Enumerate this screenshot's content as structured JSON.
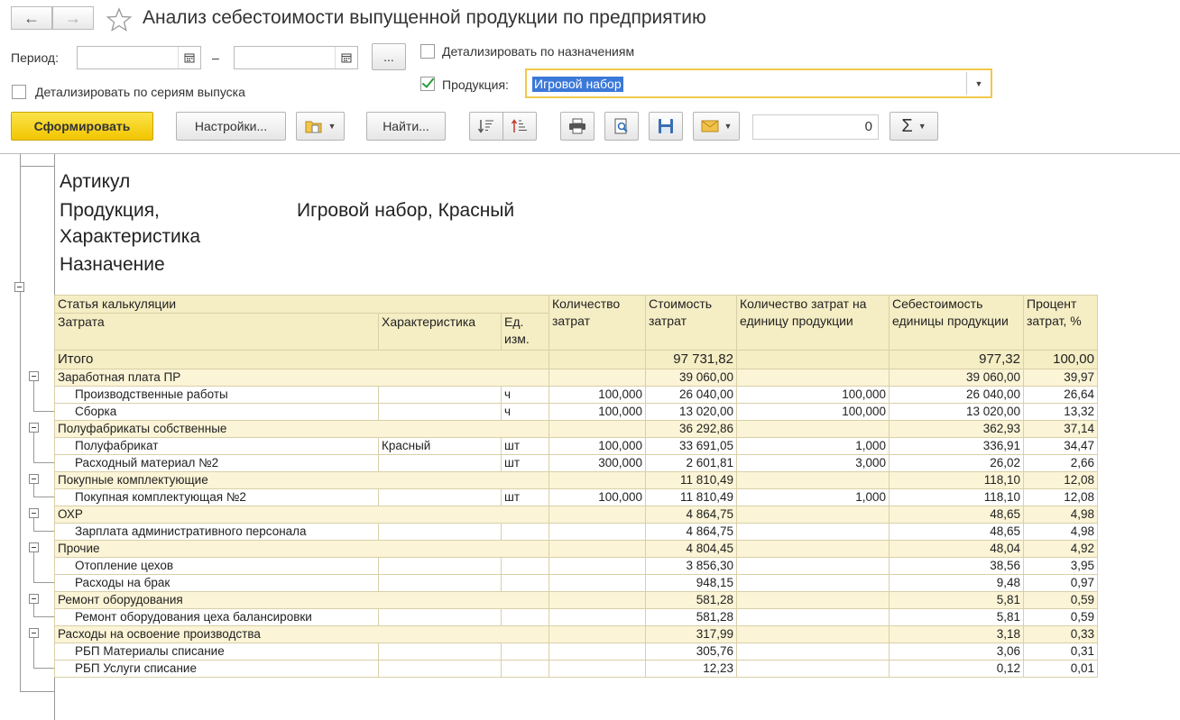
{
  "title": "Анализ себестоимости выпущенной продукции по предприятию",
  "nav": {
    "back_icon": "←",
    "forward_icon": "→"
  },
  "filters": {
    "period_label": "Период:",
    "period_dash": "–",
    "period_from": "",
    "period_to": "",
    "ellipsis": "...",
    "detail_by_purpose_label": "Детализировать по назначениям",
    "detail_by_series_label": "Детализировать по сериям выпуска",
    "product_label": "Продукция:",
    "product_value": "Игровой набор"
  },
  "toolbar": {
    "generate": "Сформировать",
    "settings": "Настройки...",
    "find": "Найти...",
    "sum_value": "0"
  },
  "report_header": {
    "article_label": "Артикул",
    "product_label_1": "Продукция,",
    "product_label_2": "Характеристика",
    "product_value": "Игровой набор, Красный",
    "purpose_label": "Назначение"
  },
  "table": {
    "headers": {
      "cost_item": "Статья калькуляции",
      "expense": "Затрата",
      "characteristic": "Характеристика",
      "unit": "Ед. изм.",
      "qty": "Количество затрат",
      "cost": "Стоимость затрат",
      "qty_per_unit": "Количество затрат на единицу продукции",
      "unit_cost": "Себестоимость единицы продукции",
      "pct": "Процент затрат, %"
    },
    "total": {
      "name": "Итого",
      "cost": "97 731,82",
      "unit_cost": "977,32",
      "pct": "100,00"
    },
    "groups": [
      {
        "name": "Заработная плата ПР",
        "cost": "39 060,00",
        "unit_cost": "39 060,00",
        "pct": "39,97",
        "items": [
          {
            "name": "Производственные работы",
            "char": "",
            "unit": "ч",
            "qty": "100,000",
            "cost": "26 040,00",
            "qpu": "100,000",
            "uc": "26 040,00",
            "pct": "26,64"
          },
          {
            "name": "Сборка",
            "char": "",
            "unit": "ч",
            "qty": "100,000",
            "cost": "13 020,00",
            "qpu": "100,000",
            "uc": "13 020,00",
            "pct": "13,32"
          }
        ]
      },
      {
        "name": "Полуфабрикаты собственные",
        "cost": "36 292,86",
        "unit_cost": "362,93",
        "pct": "37,14",
        "items": [
          {
            "name": "Полуфабрикат",
            "char": "Красный",
            "unit": "шт",
            "qty": "100,000",
            "cost": "33 691,05",
            "qpu": "1,000",
            "uc": "336,91",
            "pct": "34,47"
          },
          {
            "name": "Расходный материал №2",
            "char": "",
            "unit": "шт",
            "qty": "300,000",
            "cost": "2 601,81",
            "qpu": "3,000",
            "uc": "26,02",
            "pct": "2,66"
          }
        ]
      },
      {
        "name": "Покупные комплектующие",
        "cost": "11 810,49",
        "unit_cost": "118,10",
        "pct": "12,08",
        "items": [
          {
            "name": "Покупная комплектующая №2",
            "char": "",
            "unit": "шт",
            "qty": "100,000",
            "cost": "11 810,49",
            "qpu": "1,000",
            "uc": "118,10",
            "pct": "12,08"
          }
        ]
      },
      {
        "name": "ОХР",
        "cost": "4 864,75",
        "unit_cost": "48,65",
        "pct": "4,98",
        "items": [
          {
            "name": "Зарплата административного персонала",
            "char": "",
            "unit": "",
            "qty": "",
            "cost": "4 864,75",
            "qpu": "",
            "uc": "48,65",
            "pct": "4,98"
          }
        ]
      },
      {
        "name": "Прочие",
        "cost": "4 804,45",
        "unit_cost": "48,04",
        "pct": "4,92",
        "items": [
          {
            "name": "Отопление цехов",
            "char": "",
            "unit": "",
            "qty": "",
            "cost": "3 856,30",
            "qpu": "",
            "uc": "38,56",
            "pct": "3,95"
          },
          {
            "name": "Расходы на брак",
            "char": "",
            "unit": "",
            "qty": "",
            "cost": "948,15",
            "qpu": "",
            "uc": "9,48",
            "pct": "0,97"
          }
        ]
      },
      {
        "name": "Ремонт оборудования",
        "cost": "581,28",
        "unit_cost": "5,81",
        "pct": "0,59",
        "items": [
          {
            "name": "Ремонт оборудования цеха балансировки",
            "char": "",
            "unit": "",
            "qty": "",
            "cost": "581,28",
            "qpu": "",
            "uc": "5,81",
            "pct": "0,59"
          }
        ]
      },
      {
        "name": "Расходы на освоение производства",
        "cost": "317,99",
        "unit_cost": "3,18",
        "pct": "0,33",
        "items": [
          {
            "name": "РБП Материалы списание",
            "char": "",
            "unit": "",
            "qty": "",
            "cost": "305,76",
            "qpu": "",
            "uc": "3,06",
            "pct": "0,31"
          },
          {
            "name": "РБП Услуги списание",
            "char": "",
            "unit": "",
            "qty": "",
            "cost": "12,23",
            "qpu": "",
            "uc": "0,12",
            "pct": "0,01"
          }
        ]
      }
    ]
  }
}
